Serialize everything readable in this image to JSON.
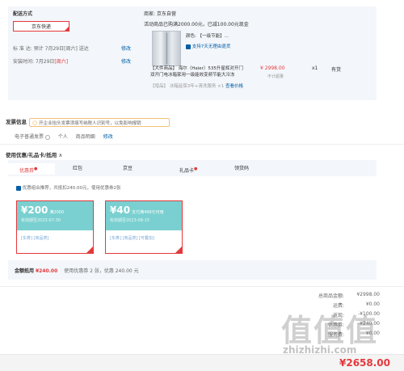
{
  "delivery": {
    "title": "配送方式",
    "option": "京东快递",
    "arrival_label": "标 准 达:",
    "arrival_value": "预计 7月29日[周六] 送达",
    "arrival_edit": "修改",
    "install_label": "安装时间:",
    "install_value": "7月29日",
    "install_day": "[周六]",
    "install_edit": "修改"
  },
  "shop": {
    "label": "商家:",
    "name": "京东自营",
    "promo": "活动商品已购满2000.00元，已减100.00元现金",
    "color_label": "颜色:",
    "color_value": "【一级节能】...",
    "return_policy": "支持7天无理由退货",
    "product_title": "【大件商品】 海尔（Haier）535升星辉对开门双开门电冰箱家用一级能效变频节能大冷冻",
    "price": "¥ 2998.00",
    "stock": "不计超量",
    "qty": "x1",
    "stock_status": "有货",
    "service_tag": "【增品】",
    "service_text": "冰箱延保3年+清洗服务 ×1",
    "service_link": "查看价格"
  },
  "invoice": {
    "title": "发票信息",
    "tip": "开企业抬头发票须填写纳税人识别号，以免影响报销",
    "type": "电子普通发票",
    "personal": "个人",
    "detail": "商品明细",
    "edit": "修改"
  },
  "coupons": {
    "title": "使用优惠/礼品卡/抵用",
    "tabs": [
      {
        "label": "优惠券",
        "star": "●"
      },
      {
        "label": "红包",
        "star": ""
      },
      {
        "label": "京豆",
        "star": ""
      },
      {
        "label": "礼品卡",
        "star": "●"
      },
      {
        "label": "领货码",
        "star": ""
      }
    ],
    "optimal_note": "优惠组合推荐，共抵扣240.00元，使用优惠券2张",
    "cards": [
      {
        "amount": "¥200",
        "cond": "满2000",
        "date": "有效期至2023-07-30",
        "tags": "[东券] [商品类]"
      },
      {
        "amount": "¥40",
        "cond": "支付满499元可用",
        "date": "有效期至2023-08-15",
        "tags": "[东券] [商品类] [可叠加]"
      }
    ],
    "footer_label": "金额抵用",
    "footer_amount": "¥240.00",
    "footer_note": "使用优惠券 2 张，优惠 240.00 元"
  },
  "summary": {
    "rows": [
      {
        "label": "总商品金额:",
        "value": "¥2998.00"
      },
      {
        "label": "运费:",
        "value": "¥0.00"
      },
      {
        "label": "返现:",
        "value": "-¥100.00"
      },
      {
        "label": "优惠券:",
        "value": "-¥240.00"
      },
      {
        "label": "服务费:",
        "value": "¥0.00"
      }
    ],
    "total": "¥2658.00"
  },
  "watermark": {
    "glyphs": "值值值",
    "url": "zhizhizhi.com"
  },
  "colors": {
    "accent": "#e4393c",
    "link": "#005ea7",
    "panel": "#f3f6fa",
    "coupon": "#7ad0d0"
  }
}
